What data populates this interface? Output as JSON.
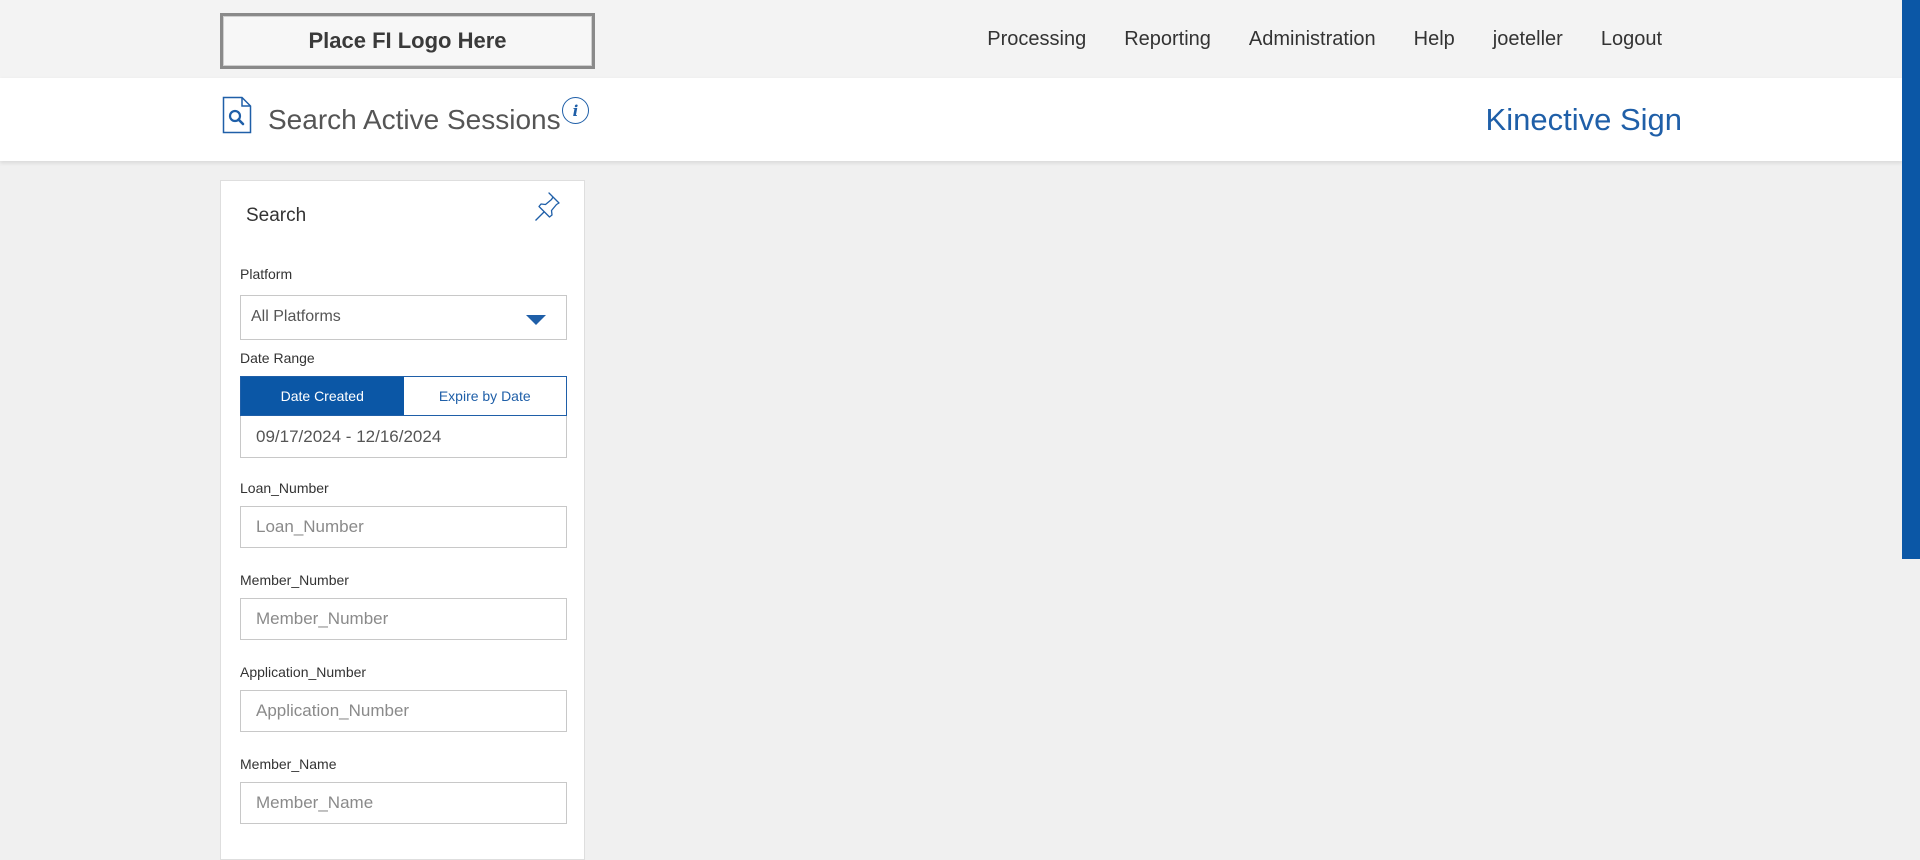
{
  "header": {
    "logo_text": "Place FI Logo Here",
    "nav": [
      "Processing",
      "Reporting",
      "Administration",
      "Help",
      "joeteller",
      "Logout"
    ]
  },
  "page": {
    "title": "Search Active Sessions",
    "info_glyph": "i",
    "brand": "Kinective Sign",
    "icons": [
      "search-document-icon",
      "info-icon",
      "pin-icon",
      "chevron-down-icon"
    ]
  },
  "colors": {
    "accent": "#0b57a6",
    "link": "#1f5fa8",
    "background": "#f0f0f0"
  },
  "search_panel": {
    "title": "Search",
    "platform": {
      "label": "Platform",
      "selected": "All Platforms"
    },
    "date_range": {
      "label": "Date Range",
      "options": [
        "Date Created",
        "Expire by Date"
      ],
      "active": "Date Created",
      "value": "09/17/2024 - 12/16/2024"
    },
    "fields": [
      {
        "label": "Loan_Number",
        "placeholder": "Loan_Number"
      },
      {
        "label": "Member_Number",
        "placeholder": "Member_Number"
      },
      {
        "label": "Application_Number",
        "placeholder": "Application_Number"
      },
      {
        "label": "Member_Name",
        "placeholder": "Member_Name"
      }
    ]
  }
}
